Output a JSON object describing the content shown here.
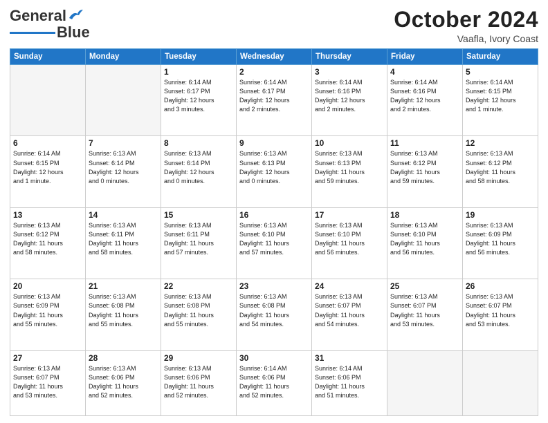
{
  "logo": {
    "line1": "General",
    "line2": "Blue"
  },
  "title": "October 2024",
  "subtitle": "Vaafla, Ivory Coast",
  "days_of_week": [
    "Sunday",
    "Monday",
    "Tuesday",
    "Wednesday",
    "Thursday",
    "Friday",
    "Saturday"
  ],
  "weeks": [
    [
      {
        "day": "",
        "empty": true
      },
      {
        "day": "",
        "empty": true
      },
      {
        "day": "1",
        "info": "Sunrise: 6:14 AM\nSunset: 6:17 PM\nDaylight: 12 hours\nand 3 minutes."
      },
      {
        "day": "2",
        "info": "Sunrise: 6:14 AM\nSunset: 6:17 PM\nDaylight: 12 hours\nand 2 minutes."
      },
      {
        "day": "3",
        "info": "Sunrise: 6:14 AM\nSunset: 6:16 PM\nDaylight: 12 hours\nand 2 minutes."
      },
      {
        "day": "4",
        "info": "Sunrise: 6:14 AM\nSunset: 6:16 PM\nDaylight: 12 hours\nand 2 minutes."
      },
      {
        "day": "5",
        "info": "Sunrise: 6:14 AM\nSunset: 6:15 PM\nDaylight: 12 hours\nand 1 minute."
      }
    ],
    [
      {
        "day": "6",
        "info": "Sunrise: 6:14 AM\nSunset: 6:15 PM\nDaylight: 12 hours\nand 1 minute."
      },
      {
        "day": "7",
        "info": "Sunrise: 6:13 AM\nSunset: 6:14 PM\nDaylight: 12 hours\nand 0 minutes."
      },
      {
        "day": "8",
        "info": "Sunrise: 6:13 AM\nSunset: 6:14 PM\nDaylight: 12 hours\nand 0 minutes."
      },
      {
        "day": "9",
        "info": "Sunrise: 6:13 AM\nSunset: 6:13 PM\nDaylight: 12 hours\nand 0 minutes."
      },
      {
        "day": "10",
        "info": "Sunrise: 6:13 AM\nSunset: 6:13 PM\nDaylight: 11 hours\nand 59 minutes."
      },
      {
        "day": "11",
        "info": "Sunrise: 6:13 AM\nSunset: 6:12 PM\nDaylight: 11 hours\nand 59 minutes."
      },
      {
        "day": "12",
        "info": "Sunrise: 6:13 AM\nSunset: 6:12 PM\nDaylight: 11 hours\nand 58 minutes."
      }
    ],
    [
      {
        "day": "13",
        "info": "Sunrise: 6:13 AM\nSunset: 6:12 PM\nDaylight: 11 hours\nand 58 minutes."
      },
      {
        "day": "14",
        "info": "Sunrise: 6:13 AM\nSunset: 6:11 PM\nDaylight: 11 hours\nand 58 minutes."
      },
      {
        "day": "15",
        "info": "Sunrise: 6:13 AM\nSunset: 6:11 PM\nDaylight: 11 hours\nand 57 minutes."
      },
      {
        "day": "16",
        "info": "Sunrise: 6:13 AM\nSunset: 6:10 PM\nDaylight: 11 hours\nand 57 minutes."
      },
      {
        "day": "17",
        "info": "Sunrise: 6:13 AM\nSunset: 6:10 PM\nDaylight: 11 hours\nand 56 minutes."
      },
      {
        "day": "18",
        "info": "Sunrise: 6:13 AM\nSunset: 6:10 PM\nDaylight: 11 hours\nand 56 minutes."
      },
      {
        "day": "19",
        "info": "Sunrise: 6:13 AM\nSunset: 6:09 PM\nDaylight: 11 hours\nand 56 minutes."
      }
    ],
    [
      {
        "day": "20",
        "info": "Sunrise: 6:13 AM\nSunset: 6:09 PM\nDaylight: 11 hours\nand 55 minutes."
      },
      {
        "day": "21",
        "info": "Sunrise: 6:13 AM\nSunset: 6:08 PM\nDaylight: 11 hours\nand 55 minutes."
      },
      {
        "day": "22",
        "info": "Sunrise: 6:13 AM\nSunset: 6:08 PM\nDaylight: 11 hours\nand 55 minutes."
      },
      {
        "day": "23",
        "info": "Sunrise: 6:13 AM\nSunset: 6:08 PM\nDaylight: 11 hours\nand 54 minutes."
      },
      {
        "day": "24",
        "info": "Sunrise: 6:13 AM\nSunset: 6:07 PM\nDaylight: 11 hours\nand 54 minutes."
      },
      {
        "day": "25",
        "info": "Sunrise: 6:13 AM\nSunset: 6:07 PM\nDaylight: 11 hours\nand 53 minutes."
      },
      {
        "day": "26",
        "info": "Sunrise: 6:13 AM\nSunset: 6:07 PM\nDaylight: 11 hours\nand 53 minutes."
      }
    ],
    [
      {
        "day": "27",
        "info": "Sunrise: 6:13 AM\nSunset: 6:07 PM\nDaylight: 11 hours\nand 53 minutes."
      },
      {
        "day": "28",
        "info": "Sunrise: 6:13 AM\nSunset: 6:06 PM\nDaylight: 11 hours\nand 52 minutes."
      },
      {
        "day": "29",
        "info": "Sunrise: 6:13 AM\nSunset: 6:06 PM\nDaylight: 11 hours\nand 52 minutes."
      },
      {
        "day": "30",
        "info": "Sunrise: 6:14 AM\nSunset: 6:06 PM\nDaylight: 11 hours\nand 52 minutes."
      },
      {
        "day": "31",
        "info": "Sunrise: 6:14 AM\nSunset: 6:06 PM\nDaylight: 11 hours\nand 51 minutes."
      },
      {
        "day": "",
        "empty": true
      },
      {
        "day": "",
        "empty": true
      }
    ]
  ]
}
